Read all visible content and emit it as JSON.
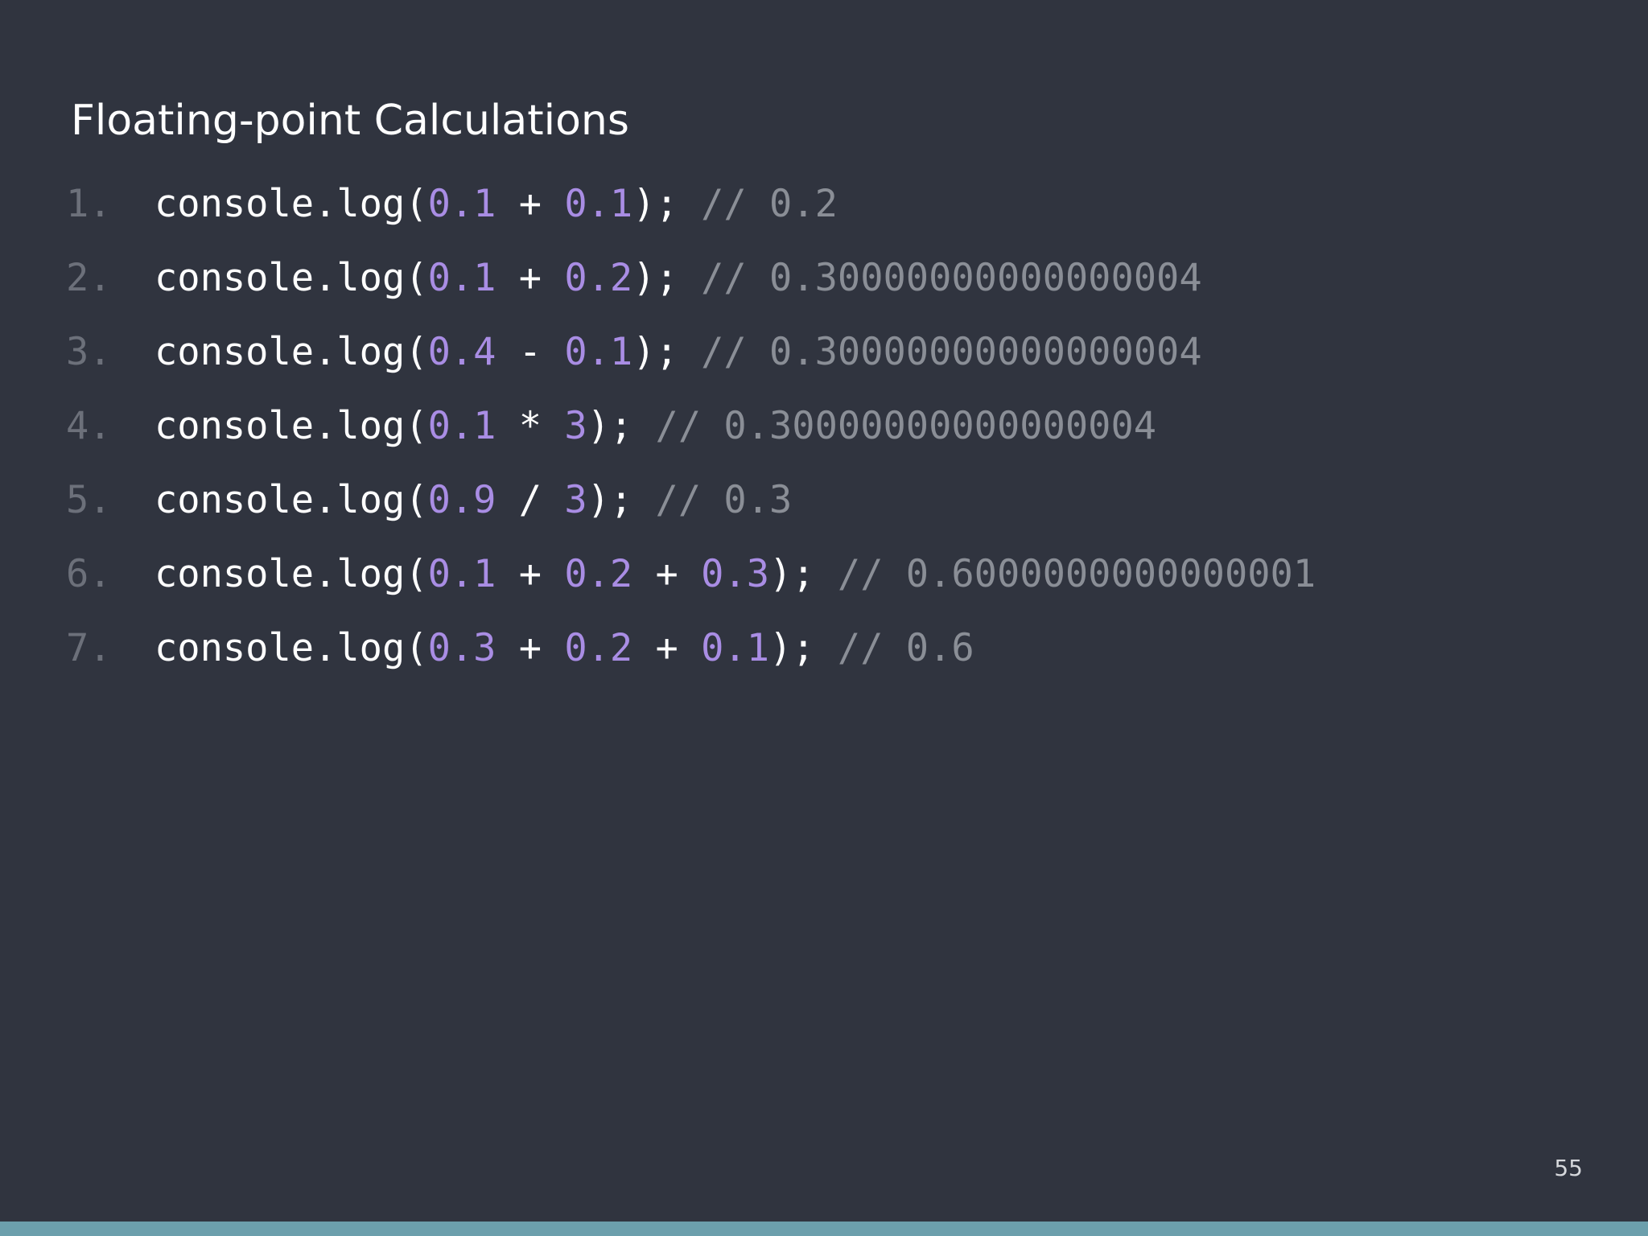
{
  "slide": {
    "title": "Floating-point Calculations",
    "page_number": "55"
  },
  "code_lines": [
    {
      "num": "1.",
      "tokens": [
        {
          "t": "console.log(",
          "k": "plain"
        },
        {
          "t": "0.1",
          "k": "num"
        },
        {
          "t": " + ",
          "k": "plain"
        },
        {
          "t": "0.1",
          "k": "num"
        },
        {
          "t": "); ",
          "k": "plain"
        },
        {
          "t": "// 0.2",
          "k": "comment"
        }
      ]
    },
    {
      "num": "2.",
      "tokens": [
        {
          "t": "console.log(",
          "k": "plain"
        },
        {
          "t": "0.1",
          "k": "num"
        },
        {
          "t": " + ",
          "k": "plain"
        },
        {
          "t": "0.2",
          "k": "num"
        },
        {
          "t": "); ",
          "k": "plain"
        },
        {
          "t": "// 0.30000000000000004",
          "k": "comment"
        }
      ]
    },
    {
      "num": "3.",
      "tokens": [
        {
          "t": "console.log(",
          "k": "plain"
        },
        {
          "t": "0.4",
          "k": "num"
        },
        {
          "t": " - ",
          "k": "plain"
        },
        {
          "t": "0.1",
          "k": "num"
        },
        {
          "t": "); ",
          "k": "plain"
        },
        {
          "t": "// 0.30000000000000004",
          "k": "comment"
        }
      ]
    },
    {
      "num": "4.",
      "tokens": [
        {
          "t": "console.log(",
          "k": "plain"
        },
        {
          "t": "0.1",
          "k": "num"
        },
        {
          "t": " * ",
          "k": "plain"
        },
        {
          "t": "3",
          "k": "num"
        },
        {
          "t": "); ",
          "k": "plain"
        },
        {
          "t": "// 0.30000000000000004",
          "k": "comment"
        }
      ]
    },
    {
      "num": "5.",
      "tokens": [
        {
          "t": "console.log(",
          "k": "plain"
        },
        {
          "t": "0.9",
          "k": "num"
        },
        {
          "t": " / ",
          "k": "plain"
        },
        {
          "t": "3",
          "k": "num"
        },
        {
          "t": "); ",
          "k": "plain"
        },
        {
          "t": "// 0.3",
          "k": "comment"
        }
      ]
    },
    {
      "num": "6.",
      "tokens": [
        {
          "t": "console.log(",
          "k": "plain"
        },
        {
          "t": "0.1",
          "k": "num"
        },
        {
          "t": " + ",
          "k": "plain"
        },
        {
          "t": "0.2",
          "k": "num"
        },
        {
          "t": " + ",
          "k": "plain"
        },
        {
          "t": "0.3",
          "k": "num"
        },
        {
          "t": "); ",
          "k": "plain"
        },
        {
          "t": "// 0.6000000000000001",
          "k": "comment"
        }
      ]
    },
    {
      "num": "7.",
      "tokens": [
        {
          "t": "console.log(",
          "k": "plain"
        },
        {
          "t": "0.3",
          "k": "num"
        },
        {
          "t": " + ",
          "k": "plain"
        },
        {
          "t": "0.2",
          "k": "num"
        },
        {
          "t": " + ",
          "k": "plain"
        },
        {
          "t": "0.1",
          "k": "num"
        },
        {
          "t": "); ",
          "k": "plain"
        },
        {
          "t": "// 0.6",
          "k": "comment"
        }
      ]
    }
  ],
  "colors": {
    "background": "#30343f",
    "text": "#ffffff",
    "number": "#a98de4",
    "comment": "#8a8e96",
    "line_number": "#6c707a",
    "bottom_bar": "#6c9fac"
  }
}
